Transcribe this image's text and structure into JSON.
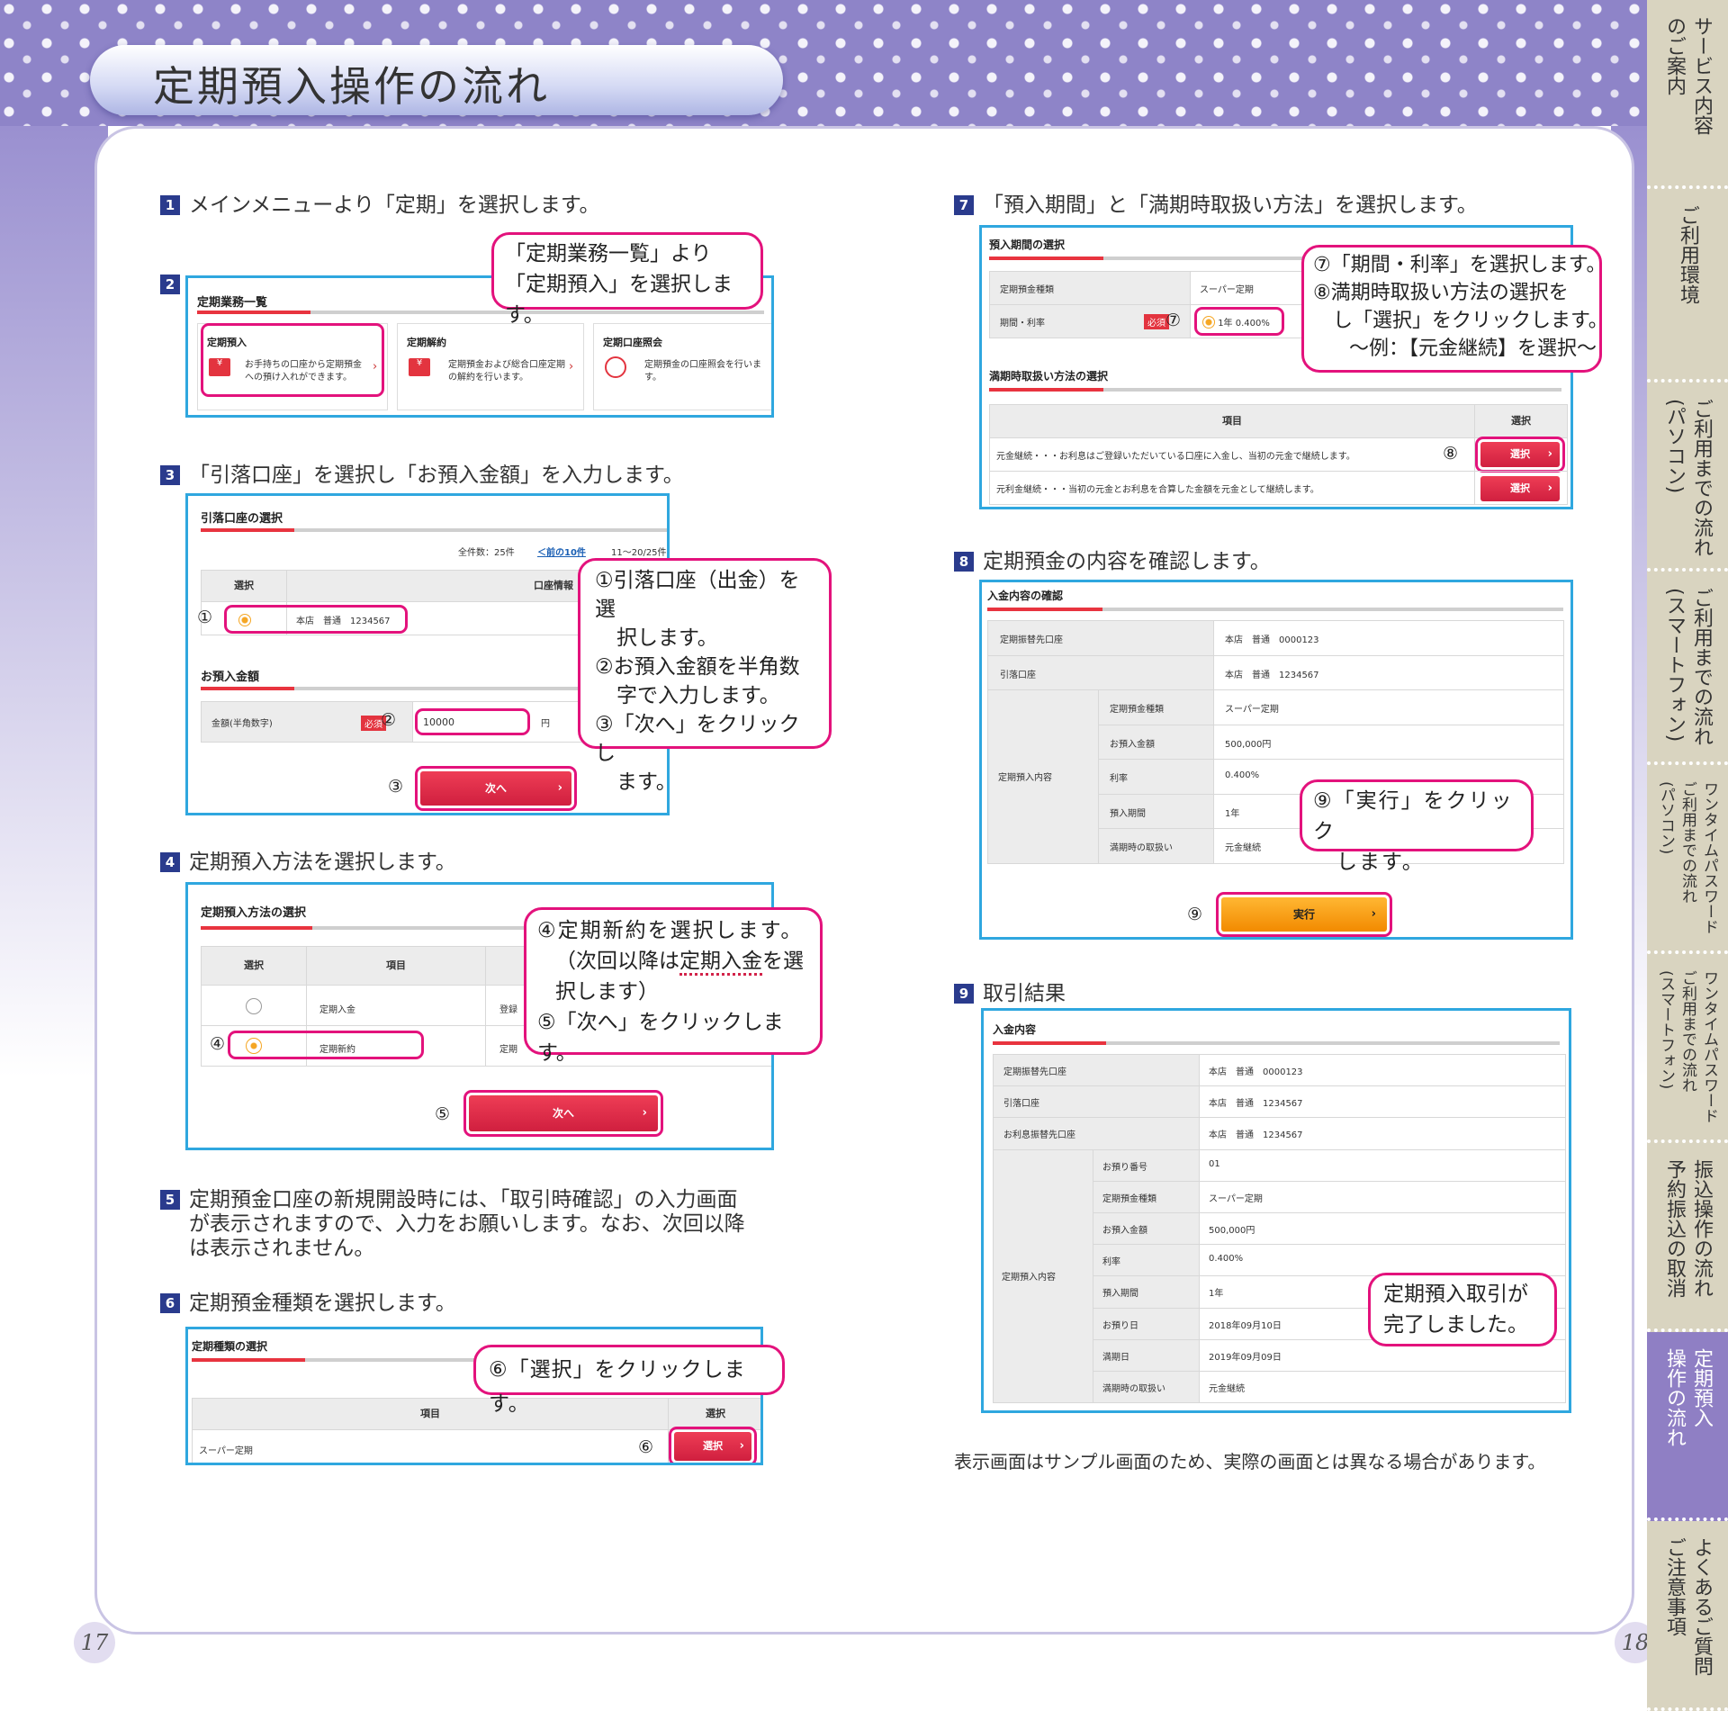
{
  "header": {
    "title": "定期預入操作の流れ"
  },
  "pages": {
    "left": "17",
    "right": "18"
  },
  "tabs": [
    {
      "line1": "サービス内容",
      "line2": "のご案内"
    },
    {
      "line1": "ご利用環境",
      "line2": ""
    },
    {
      "line1": "ご利用までの流れ",
      "line2": "(パソコン)"
    },
    {
      "line1": "ご利用までの流れ",
      "line2": "(スマートフォン)"
    },
    {
      "line1": "ワンタイムパスワード",
      "line2": "ご利用までの流れ",
      "line3": "(パソコン)"
    },
    {
      "line1": "ワンタイムパスワード",
      "line2": "ご利用までの流れ",
      "line3": "(スマートフォン)"
    },
    {
      "line1": "振込操作の流れ",
      "line2": "予約振込の取消"
    },
    {
      "line1": "定期預入",
      "line2": "操作の流れ"
    },
    {
      "line1": "よくあるご質問",
      "line2": "ご注意事項"
    }
  ],
  "steps": {
    "s1": {
      "num": "1",
      "text": "メインメニューより「定期」を選択します。"
    },
    "s2": {
      "num": "2",
      "callout1": "「定期業務一覧」より",
      "callout2": "「定期預入」を選択します。",
      "section": "定期業務一覧",
      "cards": [
        {
          "title": "定期預入",
          "desc1": "お手持ちの口座から定期預金",
          "desc2": "への預け入れができます。"
        },
        {
          "title": "定期解約",
          "desc1": "定期預金および総合口座定期",
          "desc2": "の解約を行います。"
        },
        {
          "title": "定期口座照会",
          "desc1": "定期預金の口座照会を行いま",
          "desc2": "す。"
        }
      ]
    },
    "s3": {
      "num": "3",
      "text": "「引落口座」を選択し「お預入金額」を入力します。",
      "section1": "引落口座の選択",
      "count": "全件数：25件",
      "prev": "＜前の10件",
      "range": "11〜20/25件",
      "col_select": "選択",
      "col_info": "口座情報",
      "account": "本店　普通　1234567",
      "section2": "お預入金額",
      "amount_label": "金額(半角数字)",
      "must": "必須",
      "amount_value": "10000",
      "yen": "円",
      "next": "次へ",
      "n1": "①",
      "n2": "②",
      "n3": "③",
      "c1": "①引落口座（出金）を選",
      "c2": "択します。",
      "c3": "②お預入金額を半角数",
      "c4": "字で入力します。",
      "c5": "③「次へ」をクリックし",
      "c6": "ます。"
    },
    "s4": {
      "num": "4",
      "text": "定期預入方法を選択します。",
      "section": "定期預入方法の選択",
      "col_select": "選択",
      "col_item": "項目",
      "row1": "定期入金",
      "row1_extra": "登録",
      "row2": "定期新約",
      "row2_extra": "定期",
      "next": "次へ",
      "n4": "④",
      "n5": "⑤",
      "c1": "④定期新約を選択します。",
      "c2": "（次回以降は",
      "c2u": "定期入金",
      "c2b": "を選",
      "c3": "択します）",
      "c4": "⑤「次へ」をクリックします。"
    },
    "s5": {
      "num": "5",
      "line1": "定期預金口座の新規開設時には、「取引時確認」の入力画面",
      "line2": "が表示されますので、入力をお願いします。なお、次回以降",
      "line3": "は表示されません。"
    },
    "s6": {
      "num": "6",
      "text": "定期預金種類を選択します。",
      "section": "定期種類の選択",
      "col_item": "項目",
      "col_select": "選択",
      "row": "スーパー定期",
      "btn": "選択",
      "n6": "⑥",
      "callout": "⑥「選択」をクリックします。"
    },
    "s7": {
      "num": "7",
      "text": "「預入期間」と「満期時取扱い方法」を選択します。",
      "section1": "預入期間の選択",
      "r1_label": "定期預金種類",
      "r1_value": "スーパー定期",
      "r2_label": "期間・利率",
      "must": "必須",
      "rate": "1年 0.400%",
      "section2": "満期時取扱い方法の選択",
      "col_item": "項目",
      "col_select": "選択",
      "opt1": "元金継続・・・お利息はご登録いただいている口座に入金し、当初の元金で継続します。",
      "opt2": "元利金継続・・・当初の元金とお利息を合算した金額を元金として継続します。",
      "btn": "選択",
      "n7": "⑦",
      "n8": "⑧",
      "c1": "⑦「期間・利率」を選択します。",
      "c2": "⑧満期時取扱い方法の選択を",
      "c3": "し「選択」をクリックします。",
      "c4": "〜例：【元金継続】を選択〜"
    },
    "s8": {
      "num": "8",
      "text": "定期預金の内容を確認します。",
      "section": "入金内容の確認",
      "rows": [
        {
          "label": "定期振替先口座",
          "value": "本店　普通　0000123"
        },
        {
          "label": "引落口座",
          "value": "本店　普通　1234567"
        }
      ],
      "group": "定期預入内容",
      "sub": [
        {
          "label": "定期預金種類",
          "value": "スーパー定期"
        },
        {
          "label": "お預入金額",
          "value": "500,000円"
        },
        {
          "label": "利率",
          "value": "0.400%"
        },
        {
          "label": "預入期間",
          "value": "1年"
        },
        {
          "label": "満期時の取扱い",
          "value": "元金継続"
        }
      ],
      "exec": "実行",
      "n9": "⑨",
      "c1": "⑨「実行」をクリック",
      "c2": "します。"
    },
    "s9": {
      "num": "9",
      "text": "取引結果",
      "section": "入金内容",
      "rows": [
        {
          "label": "定期振替先口座",
          "value": "本店　普通　0000123"
        },
        {
          "label": "引落口座",
          "value": "本店　普通　1234567"
        },
        {
          "label": "お利息振替先口座",
          "value": "本店　普通　1234567"
        }
      ],
      "group": "定期預入内容",
      "sub": [
        {
          "label": "お預り番号",
          "value": "01"
        },
        {
          "label": "定期預金種類",
          "value": "スーパー定期"
        },
        {
          "label": "お預入金額",
          "value": "500,000円"
        },
        {
          "label": "利率",
          "value": "0.400%"
        },
        {
          "label": "預入期間",
          "value": "1年"
        },
        {
          "label": "お預り日",
          "value": "2018年09月10日"
        },
        {
          "label": "満期日",
          "value": "2019年09月09日"
        },
        {
          "label": "満期時の取扱い",
          "value": "元金継続"
        }
      ],
      "c1": "定期預入取引が",
      "c2": "完了しました。"
    }
  },
  "footnote": "表示画面はサンプル画面のため、実際の画面とは異なる場合があります。"
}
